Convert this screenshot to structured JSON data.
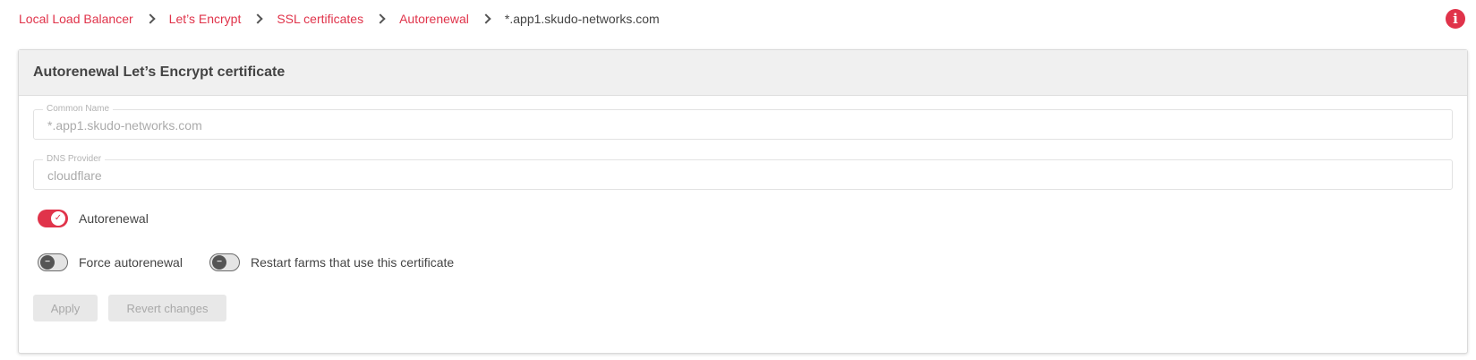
{
  "breadcrumb": {
    "items": [
      "Local Load Balancer",
      "Let’s Encrypt",
      "SSL certificates",
      "Autorenewal"
    ],
    "current": "*.app1.skudo-networks.com"
  },
  "header": {
    "info_icon": "i"
  },
  "card": {
    "title": "Autorenewal Let’s Encrypt certificate",
    "common_name": {
      "label": "Common Name",
      "value": "*.app1.skudo-networks.com"
    },
    "dns_provider": {
      "label": "DNS Provider",
      "value": "cloudflare"
    },
    "toggles": {
      "autorenewal": {
        "label": "Autorenewal",
        "state": "on"
      },
      "force_autorenewal": {
        "label": "Force autorenewal",
        "state": "off"
      },
      "restart_farms": {
        "label": "Restart farms that use this certificate",
        "state": "off"
      }
    },
    "buttons": {
      "apply": "Apply",
      "revert": "Revert changes"
    }
  },
  "colors": {
    "accent": "#e0334a",
    "disabled": "#e8e8e8"
  },
  "icons": {
    "separator": "chevron-right-icon",
    "info": "info-icon",
    "check": "check-icon",
    "minus": "minus-icon"
  }
}
